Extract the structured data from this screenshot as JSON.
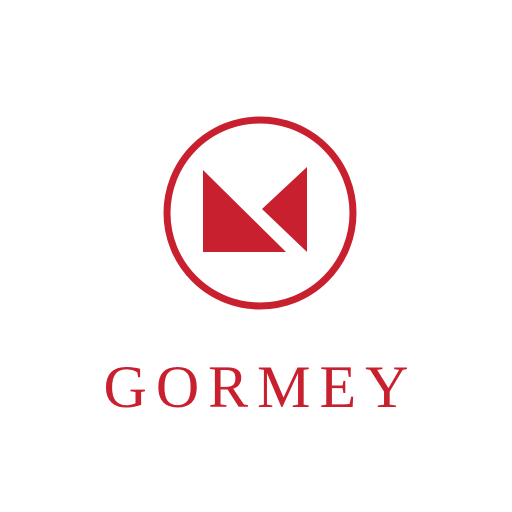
{
  "brand": {
    "name": "GORMEY",
    "accent_color": "#c8202f",
    "background_color": "#ffffff"
  },
  "emblem": {
    "icon": "m-monogram-circle-icon"
  }
}
